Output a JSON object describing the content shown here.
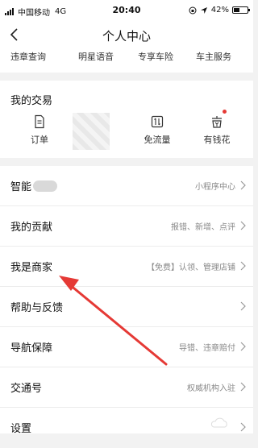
{
  "status_bar": {
    "carrier": "中国移动",
    "network": "4G",
    "time": "20:40",
    "battery": "42%",
    "battery_fraction": 0.42
  },
  "nav": {
    "title": "个人中心"
  },
  "services": [
    {
      "label": "违章查询"
    },
    {
      "label": "明星语音"
    },
    {
      "label": "专享车险"
    },
    {
      "label": "车主服务"
    }
  ],
  "transactions": {
    "title": "我的交易",
    "items": [
      {
        "label": "订单",
        "icon": "document-icon"
      },
      {
        "label": "免流量",
        "icon": "data-free-icon"
      },
      {
        "label": "有钱花",
        "icon": "wallet-icon"
      }
    ]
  },
  "menu": {
    "smart": {
      "title": "智能",
      "sub": "小程序中心"
    },
    "contribution": {
      "title": "我的贡献",
      "sub": "报错、新增、点评"
    },
    "merchant": {
      "title": "我是商家",
      "sub": "【免费】认领、管理店铺"
    },
    "help": {
      "title": "帮助与反馈",
      "sub": ""
    },
    "nav_guarantee": {
      "title": "导航保障",
      "sub": "导错、违章赔付"
    },
    "traffic": {
      "title": "交通号",
      "sub": "权威机构入驻"
    },
    "settings": {
      "title": "设置",
      "sub": ""
    }
  },
  "colors": {
    "accent_red": "#e53935",
    "background": "#f2f2f2"
  }
}
